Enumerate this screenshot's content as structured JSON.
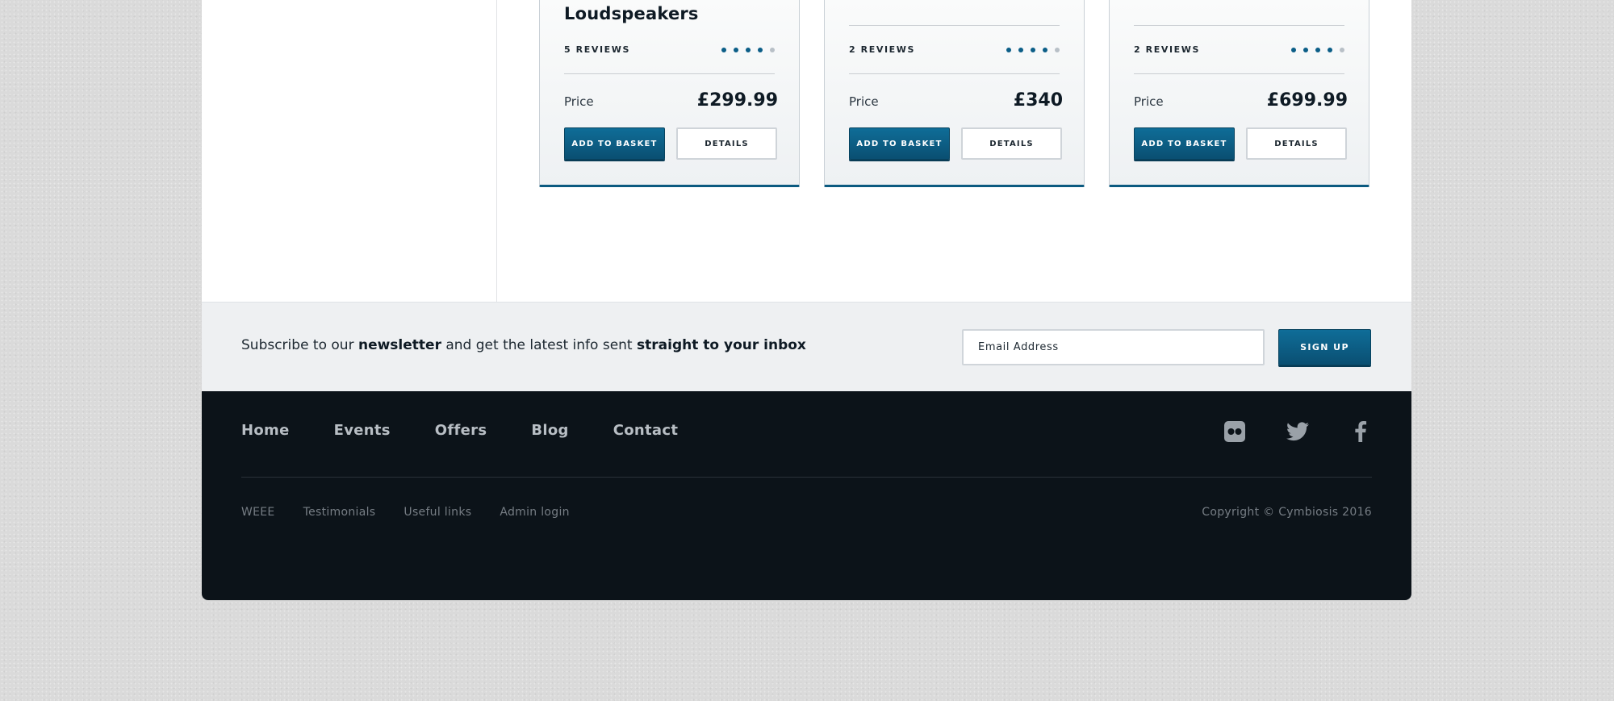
{
  "products": [
    {
      "title": "Loudspeakers",
      "reviews": "5 REVIEWS",
      "rating": 4,
      "rating_max": 5,
      "price_label": "Price",
      "price": "£299.99",
      "basket_label": "ADD TO BASKET",
      "details_label": "DETAILS"
    },
    {
      "title": "",
      "reviews": "2 REVIEWS",
      "rating": 4,
      "rating_max": 5,
      "price_label": "Price",
      "price": "£340",
      "basket_label": "ADD TO BASKET",
      "details_label": "DETAILS"
    },
    {
      "title": "",
      "reviews": "2 REVIEWS",
      "rating": 4,
      "rating_max": 5,
      "price_label": "Price",
      "price": "£699.99",
      "basket_label": "ADD TO BASKET",
      "details_label": "DETAILS"
    }
  ],
  "newsletter": {
    "text_1": "Subscribe to our ",
    "text_bold_1": "newsletter",
    "text_2": " and get the latest info sent ",
    "text_bold_2": "straight to your inbox",
    "email_placeholder": "Email Address",
    "signup_label": "SIGN UP"
  },
  "footer": {
    "nav": [
      "Home",
      "Events",
      "Offers",
      "Blog",
      "Contact"
    ],
    "social_icons": [
      "flickr-icon",
      "twitter-icon",
      "facebook-icon"
    ],
    "sub_links": [
      "WEEE",
      "Testimonials",
      "Useful links",
      "Admin login"
    ],
    "copyright": "Copyright © Cymbiosis 2016"
  },
  "colors": {
    "accent": "#0b5a80",
    "footer_bg": "#0c1319",
    "newsletter_bg": "#eef0f2"
  }
}
